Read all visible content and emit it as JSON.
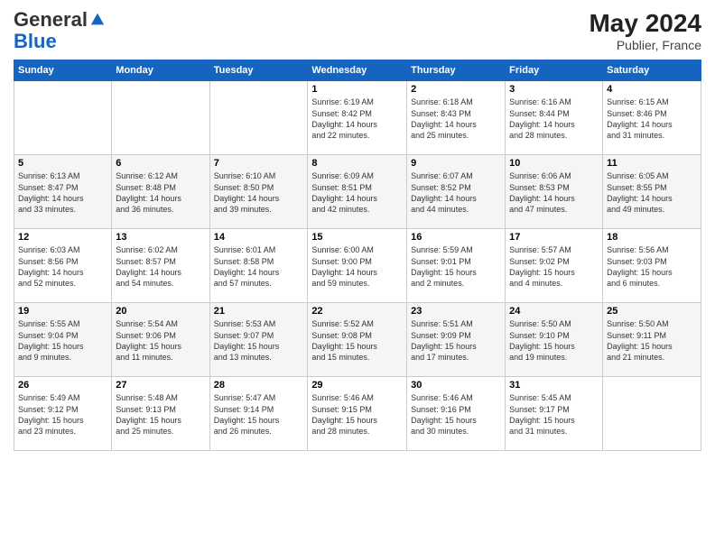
{
  "header": {
    "logo_general": "General",
    "logo_blue": "Blue",
    "month_year": "May 2024",
    "location": "Publier, France"
  },
  "days_of_week": [
    "Sunday",
    "Monday",
    "Tuesday",
    "Wednesday",
    "Thursday",
    "Friday",
    "Saturday"
  ],
  "weeks": [
    [
      {
        "day": "",
        "info": ""
      },
      {
        "day": "",
        "info": ""
      },
      {
        "day": "",
        "info": ""
      },
      {
        "day": "1",
        "info": "Sunrise: 6:19 AM\nSunset: 8:42 PM\nDaylight: 14 hours\nand 22 minutes."
      },
      {
        "day": "2",
        "info": "Sunrise: 6:18 AM\nSunset: 8:43 PM\nDaylight: 14 hours\nand 25 minutes."
      },
      {
        "day": "3",
        "info": "Sunrise: 6:16 AM\nSunset: 8:44 PM\nDaylight: 14 hours\nand 28 minutes."
      },
      {
        "day": "4",
        "info": "Sunrise: 6:15 AM\nSunset: 8:46 PM\nDaylight: 14 hours\nand 31 minutes."
      }
    ],
    [
      {
        "day": "5",
        "info": "Sunrise: 6:13 AM\nSunset: 8:47 PM\nDaylight: 14 hours\nand 33 minutes."
      },
      {
        "day": "6",
        "info": "Sunrise: 6:12 AM\nSunset: 8:48 PM\nDaylight: 14 hours\nand 36 minutes."
      },
      {
        "day": "7",
        "info": "Sunrise: 6:10 AM\nSunset: 8:50 PM\nDaylight: 14 hours\nand 39 minutes."
      },
      {
        "day": "8",
        "info": "Sunrise: 6:09 AM\nSunset: 8:51 PM\nDaylight: 14 hours\nand 42 minutes."
      },
      {
        "day": "9",
        "info": "Sunrise: 6:07 AM\nSunset: 8:52 PM\nDaylight: 14 hours\nand 44 minutes."
      },
      {
        "day": "10",
        "info": "Sunrise: 6:06 AM\nSunset: 8:53 PM\nDaylight: 14 hours\nand 47 minutes."
      },
      {
        "day": "11",
        "info": "Sunrise: 6:05 AM\nSunset: 8:55 PM\nDaylight: 14 hours\nand 49 minutes."
      }
    ],
    [
      {
        "day": "12",
        "info": "Sunrise: 6:03 AM\nSunset: 8:56 PM\nDaylight: 14 hours\nand 52 minutes."
      },
      {
        "day": "13",
        "info": "Sunrise: 6:02 AM\nSunset: 8:57 PM\nDaylight: 14 hours\nand 54 minutes."
      },
      {
        "day": "14",
        "info": "Sunrise: 6:01 AM\nSunset: 8:58 PM\nDaylight: 14 hours\nand 57 minutes."
      },
      {
        "day": "15",
        "info": "Sunrise: 6:00 AM\nSunset: 9:00 PM\nDaylight: 14 hours\nand 59 minutes."
      },
      {
        "day": "16",
        "info": "Sunrise: 5:59 AM\nSunset: 9:01 PM\nDaylight: 15 hours\nand 2 minutes."
      },
      {
        "day": "17",
        "info": "Sunrise: 5:57 AM\nSunset: 9:02 PM\nDaylight: 15 hours\nand 4 minutes."
      },
      {
        "day": "18",
        "info": "Sunrise: 5:56 AM\nSunset: 9:03 PM\nDaylight: 15 hours\nand 6 minutes."
      }
    ],
    [
      {
        "day": "19",
        "info": "Sunrise: 5:55 AM\nSunset: 9:04 PM\nDaylight: 15 hours\nand 9 minutes."
      },
      {
        "day": "20",
        "info": "Sunrise: 5:54 AM\nSunset: 9:06 PM\nDaylight: 15 hours\nand 11 minutes."
      },
      {
        "day": "21",
        "info": "Sunrise: 5:53 AM\nSunset: 9:07 PM\nDaylight: 15 hours\nand 13 minutes."
      },
      {
        "day": "22",
        "info": "Sunrise: 5:52 AM\nSunset: 9:08 PM\nDaylight: 15 hours\nand 15 minutes."
      },
      {
        "day": "23",
        "info": "Sunrise: 5:51 AM\nSunset: 9:09 PM\nDaylight: 15 hours\nand 17 minutes."
      },
      {
        "day": "24",
        "info": "Sunrise: 5:50 AM\nSunset: 9:10 PM\nDaylight: 15 hours\nand 19 minutes."
      },
      {
        "day": "25",
        "info": "Sunrise: 5:50 AM\nSunset: 9:11 PM\nDaylight: 15 hours\nand 21 minutes."
      }
    ],
    [
      {
        "day": "26",
        "info": "Sunrise: 5:49 AM\nSunset: 9:12 PM\nDaylight: 15 hours\nand 23 minutes."
      },
      {
        "day": "27",
        "info": "Sunrise: 5:48 AM\nSunset: 9:13 PM\nDaylight: 15 hours\nand 25 minutes."
      },
      {
        "day": "28",
        "info": "Sunrise: 5:47 AM\nSunset: 9:14 PM\nDaylight: 15 hours\nand 26 minutes."
      },
      {
        "day": "29",
        "info": "Sunrise: 5:46 AM\nSunset: 9:15 PM\nDaylight: 15 hours\nand 28 minutes."
      },
      {
        "day": "30",
        "info": "Sunrise: 5:46 AM\nSunset: 9:16 PM\nDaylight: 15 hours\nand 30 minutes."
      },
      {
        "day": "31",
        "info": "Sunrise: 5:45 AM\nSunset: 9:17 PM\nDaylight: 15 hours\nand 31 minutes."
      },
      {
        "day": "",
        "info": ""
      }
    ]
  ]
}
